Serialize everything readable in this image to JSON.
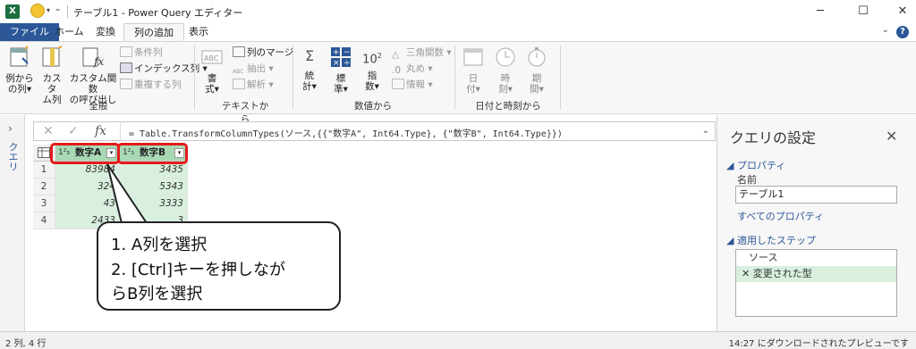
{
  "window": {
    "title": "テーブル1 - Power Query エディター",
    "excel_logo": "X",
    "minimize": "─",
    "maximize": "☐",
    "close": "✕"
  },
  "tabs": [
    {
      "label": "ファイル"
    },
    {
      "label": "ホーム"
    },
    {
      "label": "変換"
    },
    {
      "label": "列の追加"
    },
    {
      "label": "表示"
    }
  ],
  "help_label": "?",
  "ribbon": {
    "general": {
      "label": "全般",
      "col_from_examples": [
        "例から",
        "の列"
      ],
      "custom_col": [
        "カスタ",
        "ム列"
      ],
      "invoke_func": [
        "カスタム関数",
        "の呼び出し"
      ],
      "conditional_col": "条件列",
      "index_col": "インデックス列",
      "duplicate_col": "重複する列"
    },
    "text": {
      "label": "テキストから",
      "format": [
        "書",
        "式"
      ],
      "merge_cols": "列のマージ",
      "extract": "抽出",
      "parse": "解析"
    },
    "number": {
      "label": "数値から",
      "statistics": [
        "統",
        "計"
      ],
      "standard": [
        "標",
        "準"
      ],
      "scientific": [
        "指",
        "数"
      ],
      "trig": "三角関数",
      "rounding": "丸め",
      "information": "情報"
    },
    "datetime": {
      "label": "日付と時刻から",
      "date": [
        "日",
        "付"
      ],
      "time": [
        "時",
        "刻"
      ],
      "duration": [
        "期",
        "間"
      ]
    }
  },
  "query_pane_label": "クエリ",
  "formula_bar": {
    "formula": "= Table.TransformColumnTypes(ソース,{{\"数字A\", Int64.Type}, {\"数字B\", Int64.Type}})"
  },
  "table": {
    "type_icon": "1²₃",
    "columns": [
      "数字A",
      "数字B"
    ],
    "rows": [
      {
        "num": "1",
        "a": "83984",
        "b": "3435"
      },
      {
        "num": "2",
        "a": "324",
        "b": "5343"
      },
      {
        "num": "3",
        "a": "43",
        "b": "3333"
      },
      {
        "num": "4",
        "a": "2433",
        "b": "3"
      }
    ]
  },
  "callout": {
    "line1": "1. A列を選択",
    "line2": "2. [Ctrl]キーを押しなが",
    "line3": "らB列を選択"
  },
  "settings": {
    "title": "クエリの設定",
    "properties_header": "プロパティ",
    "name_label": "名前",
    "name_value": "テーブル1",
    "all_properties": "すべてのプロパティ",
    "steps_header": "適用したステップ",
    "steps": [
      "ソース",
      "変更された型"
    ]
  },
  "status": {
    "left": "2 列, 4 行",
    "right": "14:27 にダウンロードされたプレビューです"
  },
  "colors": {
    "accent": "#2b5797",
    "selected_column": "#a8d8b4",
    "highlight_red": "#e41a1a"
  }
}
